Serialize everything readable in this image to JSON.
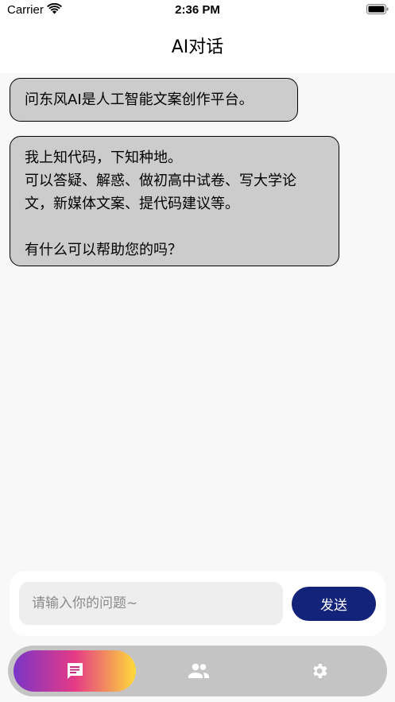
{
  "status_bar": {
    "carrier": "Carrier",
    "time": "2:36 PM"
  },
  "nav": {
    "title": "AI对话"
  },
  "messages": [
    {
      "text": "问东风AI是人工智能文案创作平台。"
    },
    {
      "text": "我上知代码，下知种地。\n可以答疑、解惑、做初高中试卷、写大学论文，新媒体文案、提代码建议等。\n\n有什么可以帮助您的吗？"
    }
  ],
  "input": {
    "placeholder": "请输入你的问题~",
    "value": ""
  },
  "send_button": {
    "label": "发送"
  },
  "tabs": [
    {
      "icon": "chat-icon",
      "active": true
    },
    {
      "icon": "contacts-icon",
      "active": false
    },
    {
      "icon": "gear-icon",
      "active": false
    }
  ],
  "colors": {
    "send_button": "#14237a",
    "bubble_bg": "#cccccc",
    "tab_bar_bg": "#c4c4c4",
    "active_tab_gradient": [
      "#7a35c8",
      "#e53a86",
      "#ffdb3a"
    ]
  }
}
